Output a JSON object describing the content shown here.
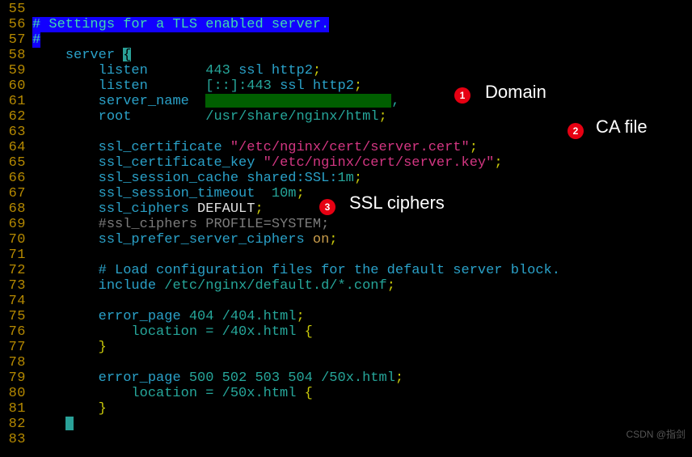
{
  "lines": {
    "55": "55",
    "56": "56",
    "57": "57",
    "58": "58",
    "59": "59",
    "60": "60",
    "61": "61",
    "62": "62",
    "63": "63",
    "64": "64",
    "65": "65",
    "66": "66",
    "67": "67",
    "68": "68",
    "69": "69",
    "70": "70",
    "71": "71",
    "72": "72",
    "73": "73",
    "74": "74",
    "75": "75",
    "76": "76",
    "77": "77",
    "78": "78",
    "79": "79",
    "80": "80",
    "81": "81",
    "82": "82",
    "83": "83"
  },
  "t": {
    "hash": "#",
    "hl56": " Settings for a TLS enabled server.",
    "server": "server",
    "listen": "listen",
    "v59": "443",
    "s59": " ssl http2",
    "semi": ";",
    "v60a": "[::]:443",
    "s60": " ssl http2",
    "server_name": "server_name",
    "sn_tail": ",",
    "root": "root",
    "rootpath": "/usr/share/nginx/html",
    "ssl_certificate": "ssl_certificate",
    "cert": "\"/etc/nginx/cert/server.cert\"",
    "ssl_certificate_key": "ssl_certificate_key",
    "key": "\"/etc/nginx/cert/server.key\"",
    "ssl_session_cache": "ssl_session_cache",
    "shared": " shared:SSL:",
    "one_m": "1m",
    "ssl_session_timeout": "ssl_session_timeout",
    "ten_m": "10m",
    "ssl_ciphers": "ssl_ciphers",
    "default": " DEFAULT",
    "cmt69": "#ssl_ciphers PROFILE=SYSTEM;",
    "ssl_prefer": "ssl_prefer_server_ciphers",
    "on": " on",
    "cmt72": "# Load configuration files for the default server block.",
    "include": "include",
    "incpath": " /etc/nginx/default.d/*.conf",
    "error_page": "error_page",
    "e404": " 404",
    "e404p": " /404.html",
    "loc76": "location = /40x.html ",
    "brace_o": "{",
    "brace_c": "}",
    "e500": " 500 502 503 504",
    "e500p": " /50x.html",
    "loc80": "location = /50x.html "
  },
  "annotations": {
    "badge1": "1",
    "label1": "Domain",
    "badge2": "2",
    "label2": "CA file",
    "badge3": "3",
    "label3": "SSL ciphers",
    "watermark": "CSDN @指剑"
  }
}
